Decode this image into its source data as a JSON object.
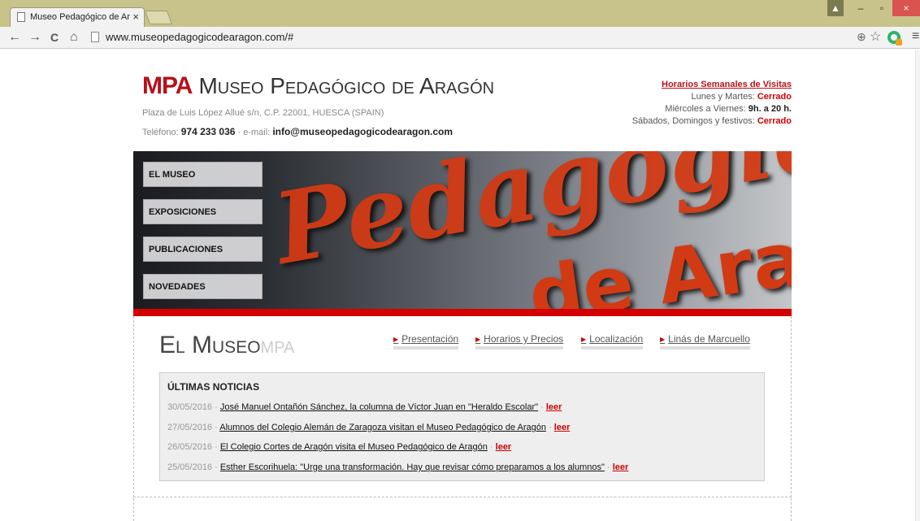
{
  "browser": {
    "tab_title": "Museo Pedagógico de Ar",
    "tab_close": "×",
    "url": "www.museopedagogicodearagon.com/#",
    "nav": {
      "back": "←",
      "forward": "→",
      "reload": "C",
      "home": "⌂"
    },
    "zoom_icon": "⊕",
    "star_icon": "☆",
    "menu_icon": "≡",
    "window": {
      "user": "▲",
      "minimize": "–",
      "restore": "▫",
      "close": "×"
    }
  },
  "site": {
    "logo_abbr": "MPA",
    "logo_name": "Museo Pedagógico de Aragón",
    "address": "Plaza de Luis López Allué s/n, C.P. 22001, HUESCA (SPAIN)",
    "phone_label": "Teléfono:",
    "phone": "974 233 036",
    "email_label": "· e-mail:",
    "email": "info@museopedagogicodearagon.com"
  },
  "hours": {
    "title": "Horarios Semanales de Visitas",
    "row1_label": "Lunes y Martes:",
    "row1_value": "Cerrado",
    "row2_label": "Miércoles a Viernes:",
    "row2_value": "9h. a 20 h.",
    "row3_label": "Sábados, Domingos y festivos:",
    "row3_value": "Cerrado"
  },
  "banner": {
    "text1": "Pedagógico",
    "text2": "de Aragón"
  },
  "menu": [
    "EL MUSEO",
    "EXPOSICIONES",
    "PUBLICACIONES",
    "NOVEDADES"
  ],
  "section": {
    "title_main": "El Museo",
    "title_sub": "MPA",
    "links": [
      "Presentación",
      "Horarios y Precios",
      "Localización",
      "Linás de Marcuello"
    ]
  },
  "news": {
    "title": "ÚLTIMAS NOTICIAS",
    "items": [
      {
        "date": "30/05/2016 ·",
        "headline": "José Manuel Ontañón Sánchez, la columna de Víctor Juan en \"Heraldo Escolar\"",
        "sep": "·",
        "more": "leer"
      },
      {
        "date": "27/05/2016 ·",
        "headline": "Alumnos del Colegio Alemán de Zaragoza visitan el Museo Pedagógico de Aragón",
        "sep": "·",
        "more": "leer"
      },
      {
        "date": "26/05/2016 ·",
        "headline": "El Colegio Cortes de Aragón visita el Museo Pedagógico de Aragón",
        "sep": "·",
        "more": "leer"
      },
      {
        "date": "25/05/2016 ·",
        "headline": "Esther Escorihuela: \"Urge una transformación. Hay que revisar cómo preparamos a los alumnos\"",
        "sep": "·",
        "more": "leer"
      }
    ]
  },
  "colors": {
    "brand_red": "#b5121b",
    "accent_red": "#d40000",
    "chrome_tabstrip": "#c8c38a"
  }
}
